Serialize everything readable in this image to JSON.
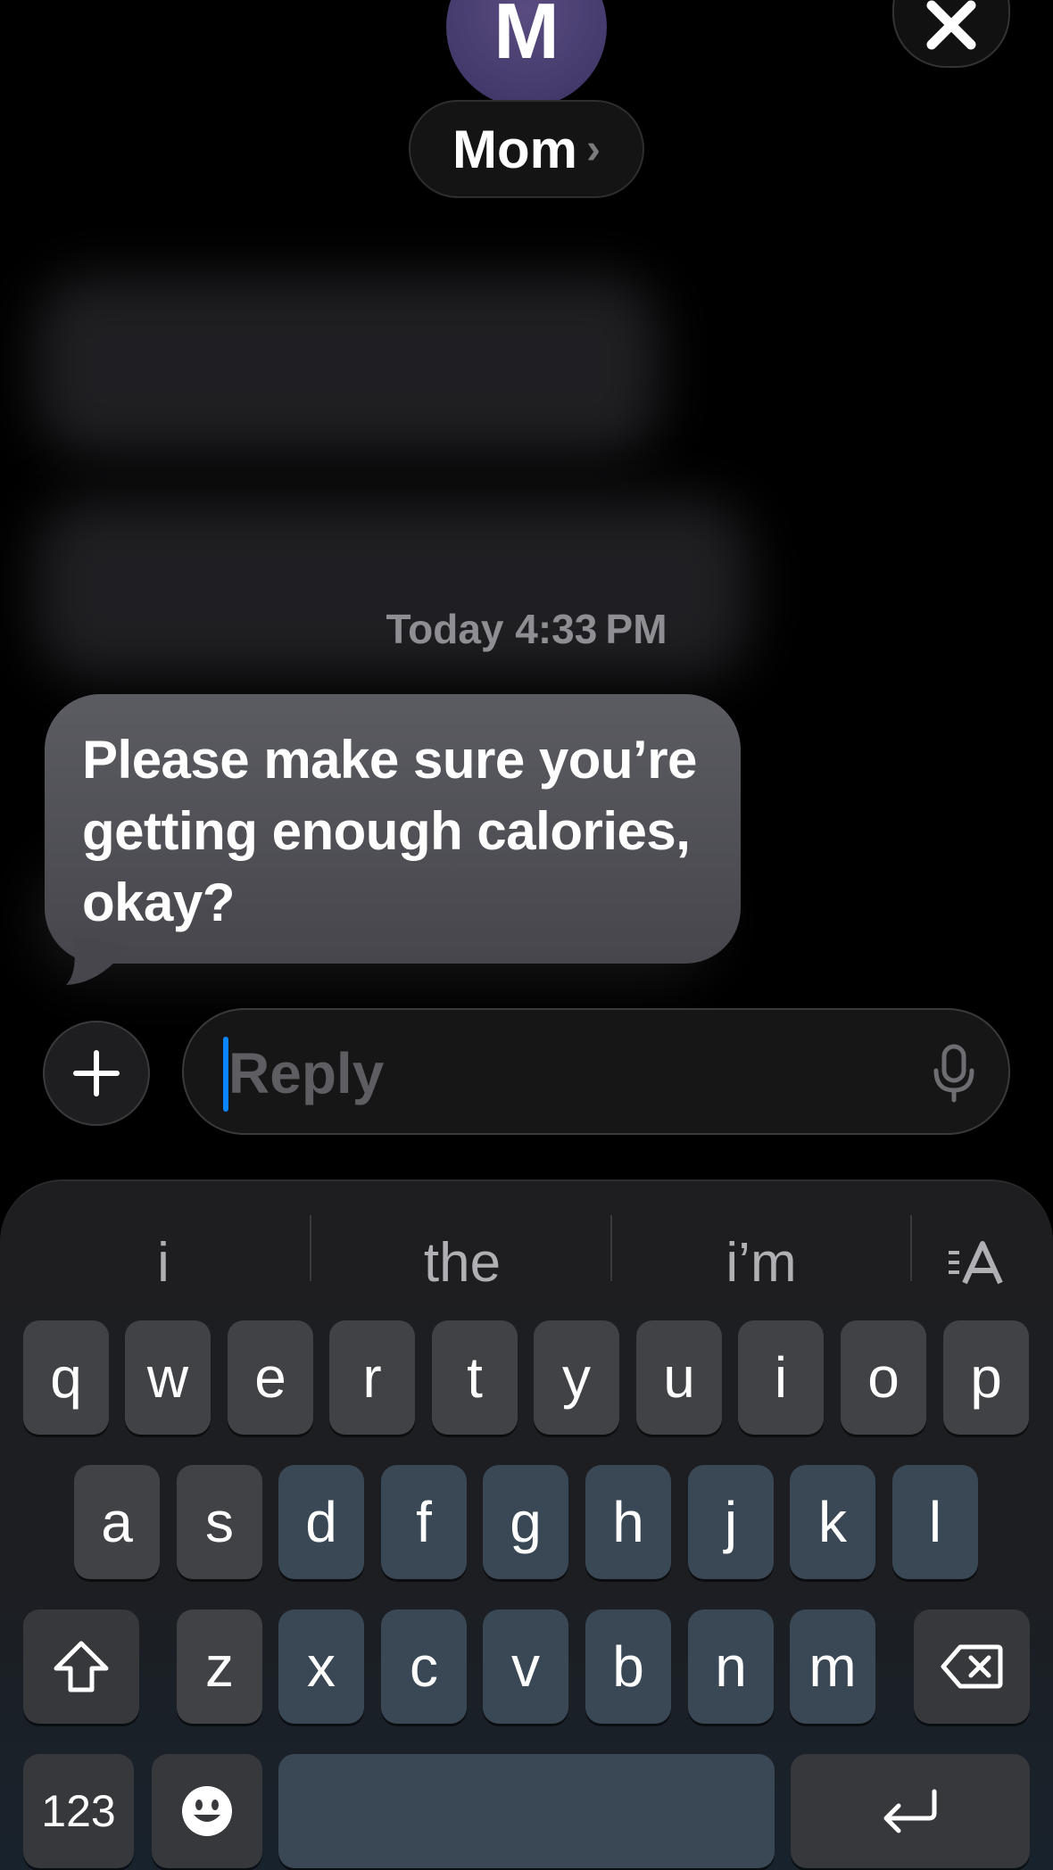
{
  "contact": {
    "initial": "M",
    "name": "Mom",
    "chevron": "›"
  },
  "header": {
    "close_icon": "close-icon"
  },
  "conversation": {
    "timestamp": "Today 4:33 PM",
    "message": "Please make sure you’re getting enough calories, okay?"
  },
  "composer": {
    "placeholder": "Reply",
    "plus_icon": "plus-icon",
    "mic_icon": "microphone-icon"
  },
  "keyboard": {
    "suggestions": [
      "i",
      "the",
      "i’m"
    ],
    "row1": [
      "q",
      "w",
      "e",
      "r",
      "t",
      "y",
      "u",
      "i",
      "o",
      "p"
    ],
    "row2": [
      "a",
      "s",
      "d",
      "f",
      "g",
      "h",
      "j",
      "k",
      "l"
    ],
    "row3": [
      "z",
      "x",
      "c",
      "v",
      "b",
      "n",
      "m"
    ],
    "numbers_label": "123",
    "icons": {
      "shift": "shift-icon",
      "delete": "delete-icon",
      "emoji": "emoji-icon",
      "return": "return-icon",
      "text_size": "text-format-icon"
    }
  },
  "colors": {
    "accent": "#0a84ff",
    "bubble": "#4f4f55",
    "background": "#000000"
  }
}
